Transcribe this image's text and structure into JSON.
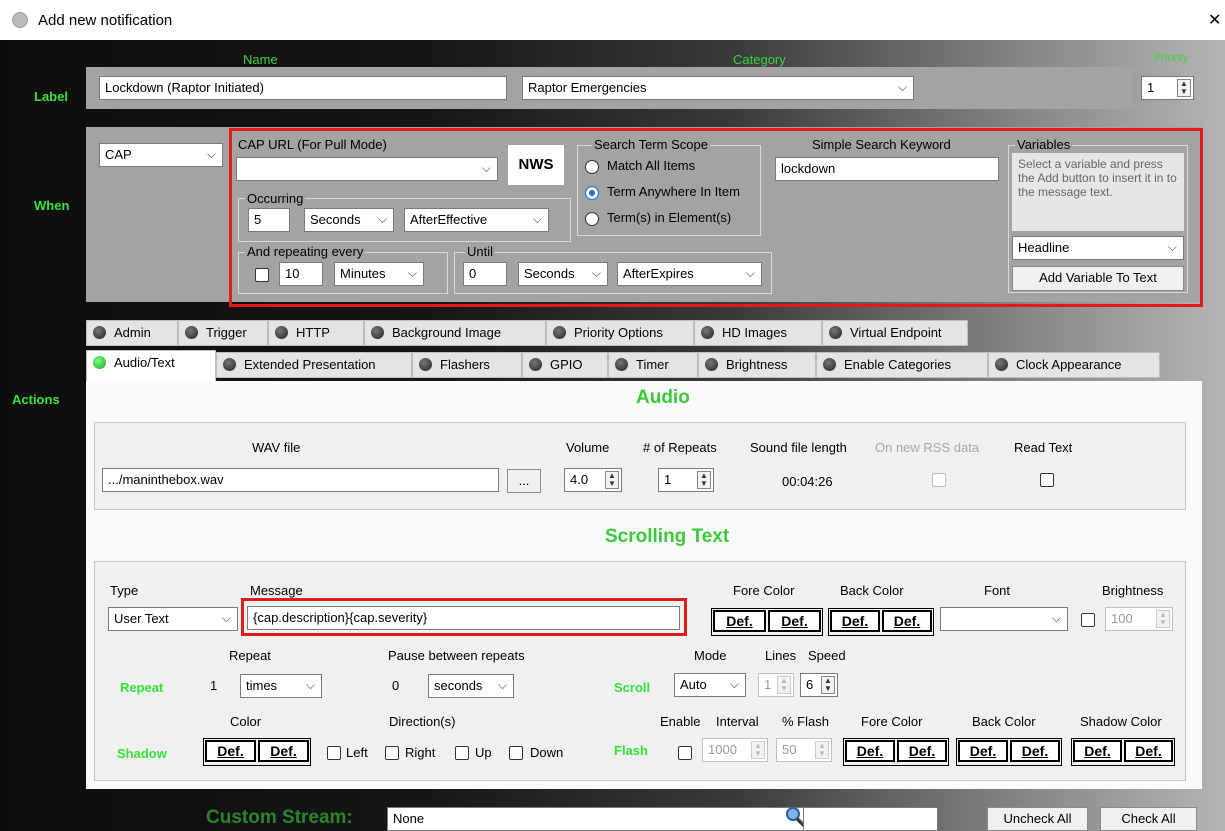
{
  "window": {
    "title": "Add new notification",
    "close": "✕"
  },
  "label_row": {
    "section": "Label",
    "name_header": "Name",
    "name_value": "Lockdown (Raptor Initiated)",
    "category_header": "Category",
    "category_value": "Raptor Emergencies",
    "priority_header": "Priority",
    "priority_value": "1"
  },
  "when": {
    "section": "When",
    "source_value": "CAP",
    "cap_url_label": "CAP URL (For Pull Mode)",
    "cap_url_value": "",
    "nws_button": "NWS",
    "occurring_label": "Occurring",
    "occurring_value": "5",
    "occurring_unit": "Seconds",
    "occurring_mode": "AfterEffective",
    "repeat_label": "And repeating every",
    "repeat_value": "10",
    "repeat_unit": "Minutes",
    "until_label": "Until",
    "until_value": "0",
    "until_unit": "Seconds",
    "until_mode": "AfterExpires",
    "scope_label": "Search Term Scope",
    "scope_options": [
      "Match All Items",
      "Term Anywhere In Item",
      "Term(s) in Element(s)"
    ],
    "keyword_label": "Simple Search Keyword",
    "keyword_value": "lockdown",
    "variables_label": "Variables",
    "variables_help": "Select a variable and press the Add button to insert it in to the message text.",
    "variable_selected": "Headline",
    "add_variable_button": "Add Variable To Text"
  },
  "actions": {
    "section": "Actions",
    "tabs_row1": [
      "Admin",
      "Trigger",
      "HTTP",
      "Background Image",
      "Priority Options",
      "HD Images",
      "Virtual Endpoint"
    ],
    "tabs_row2": [
      "Audio/Text",
      "Extended Presentation",
      "Flashers",
      "GPIO",
      "Timer",
      "Brightness",
      "Enable Categories",
      "Clock Appearance"
    ]
  },
  "audio": {
    "title": "Audio",
    "wav_label": "WAV file",
    "wav_value": ".../maninthebox.wav",
    "browse_button": "...",
    "volume_label": "Volume",
    "volume_value": "4.0",
    "repeats_label": "# of Repeats",
    "repeats_value": "1",
    "length_label": "Sound file length",
    "length_value": "00:04:26",
    "rss_label": "On new RSS data",
    "read_label": "Read Text"
  },
  "scrolling": {
    "title": "Scrolling Text",
    "type_label": "Type",
    "type_value": "User Text",
    "message_label": "Message",
    "message_value": "{cap.description}{cap.severity}",
    "fore_label": "Fore Color",
    "back_label": "Back Color",
    "font_label": "Font",
    "brightness_label": "Brightness",
    "brightness_value": "100",
    "def": "Def.",
    "repeat_section": "Repeat",
    "repeat_label": "Repeat",
    "repeat_value": "1",
    "repeat_unit": "times",
    "pause_label": "Pause between repeats",
    "pause_value": "0",
    "pause_unit": "seconds",
    "scroll_section": "Scroll",
    "mode_label": "Mode",
    "mode_value": "Auto",
    "lines_label": "Lines",
    "lines_value": "1",
    "speed_label": "Speed",
    "speed_value": "6",
    "shadow_section": "Shadow",
    "shadow_color_label": "Color",
    "direction_label": "Direction(s)",
    "directions": [
      "Left",
      "Right",
      "Up",
      "Down"
    ],
    "flash_section": "Flash",
    "enable_label": "Enable",
    "interval_label": "Interval",
    "interval_value": "1000",
    "pflash_label": "% Flash",
    "pflash_value": "50",
    "flash_fore_label": "Fore Color",
    "flash_back_label": "Back Color",
    "flash_shadow_label": "Shadow Color"
  },
  "footer": {
    "custom_stream_label": "Custom Stream:",
    "custom_stream_value": "None",
    "search_value": "",
    "uncheck_all": "Uncheck All",
    "check_all": "Check All"
  },
  "colors": {
    "accent_green": "#39e23a",
    "highlight_red": "#e01b1b",
    "radio_blue": "#1a6fd1"
  },
  "icons": [
    "app-icon",
    "close-icon",
    "search-icon",
    "chevron-down-icon",
    "led-icon"
  ]
}
